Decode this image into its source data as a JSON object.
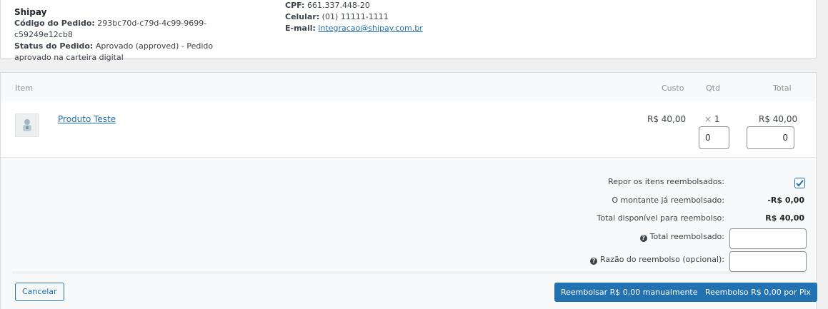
{
  "customer": {
    "shop_name": "Shipay",
    "order_code_label": "Código do Pedido:",
    "order_code": "293bc70d-c79d-4c99-9699-c59249e12cb8",
    "order_status_label": "Status do Pedido:",
    "order_status": "Aprovado (approved) - Pedido aprovado na carteira digital",
    "cpf_label": "CPF:",
    "cpf": "661.337.448-20",
    "phone_label": "Celular:",
    "phone": "(01) 11111-1111",
    "email_label": "E-mail:",
    "email": "integracao@shipay.com.br"
  },
  "table": {
    "headers": {
      "item": "Item",
      "cost": "Custo",
      "qty": "Qtd",
      "total": "Total"
    },
    "rows": [
      {
        "name": "Produto Teste",
        "cost": "R$ 40,00",
        "qty_prefix": "×",
        "qty": "1",
        "total": "R$ 40,00",
        "refund_qty": "0",
        "refund_total": "0"
      }
    ]
  },
  "refund": {
    "restock_label": "Repor os itens reembolsados:",
    "restock_checked": true,
    "already_refunded_label": "O montante já reembolsado:",
    "already_refunded": "-R$ 0,00",
    "available_label": "Total disponível para reembolso:",
    "available": "R$ 40,00",
    "refund_amount_label": "Total reembolsado:",
    "refund_amount_value": "",
    "reason_label": "Razão do reembolso (opcional):",
    "reason_value": ""
  },
  "actions": {
    "cancel": "Cancelar",
    "manual_refund": "Reembolsar R$ 0,00 manualmente",
    "pix_refund": "Reembolso R$ 0,00 por Pix"
  },
  "colors": {
    "accent": "#2271b1",
    "panel_bg": "#f8f9fa",
    "page_bg": "#f0f0f1"
  }
}
